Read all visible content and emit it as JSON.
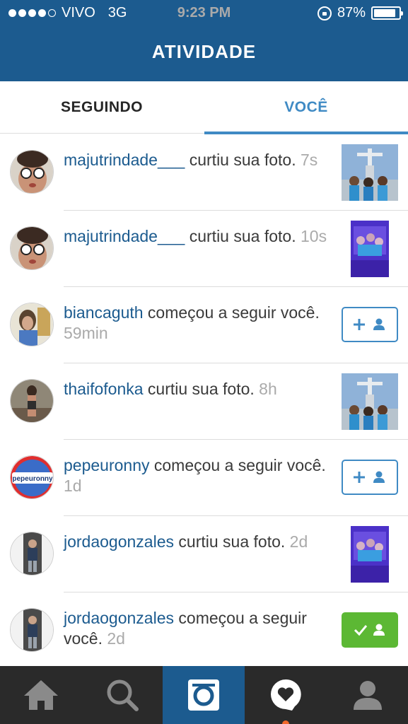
{
  "status_bar": {
    "carrier": "VIVO",
    "network": "3G",
    "time": "9:23 PM",
    "battery": "87%",
    "battery_level": 0.87
  },
  "header": {
    "title": "ATIVIDADE"
  },
  "tabs": {
    "following": "SEGUINDO",
    "you": "VOCÊ"
  },
  "items": [
    {
      "user": "majutrindade___",
      "action": " curtiu sua foto.",
      "time": " 7s",
      "right": "photo-statue"
    },
    {
      "user": "majutrindade___",
      "action": " curtiu sua foto.",
      "time": " 10s",
      "right": "photo-purple"
    },
    {
      "user": "biancaguth",
      "action": " começou a seguir você.",
      "time": " 59min",
      "right": "follow"
    },
    {
      "user": "thaifofonka",
      "action": " curtiu sua foto.",
      "time": " 8h",
      "right": "photo-statue"
    },
    {
      "user": "pepeuronny",
      "avatar_text": "pepeuronny",
      "action": " começou a seguir você.",
      "time": " 1d",
      "right": "follow"
    },
    {
      "user": "jordaogonzales",
      "action": " curtiu sua foto.",
      "time": " 2d",
      "right": "photo-purple"
    },
    {
      "user": "jordaogonzales",
      "action": " começou a seguir você.",
      "time": " 2d",
      "right": "following"
    }
  ],
  "colors": {
    "header": "#1c5b8f",
    "username": "#1c5b8f",
    "tab_active": "#3f8ac4",
    "following_green": "#5cb834",
    "tabbar": "#2a2a2a"
  },
  "nav_icons": [
    "home-icon",
    "search-icon",
    "camera-icon",
    "activity-heart-icon",
    "profile-icon"
  ]
}
